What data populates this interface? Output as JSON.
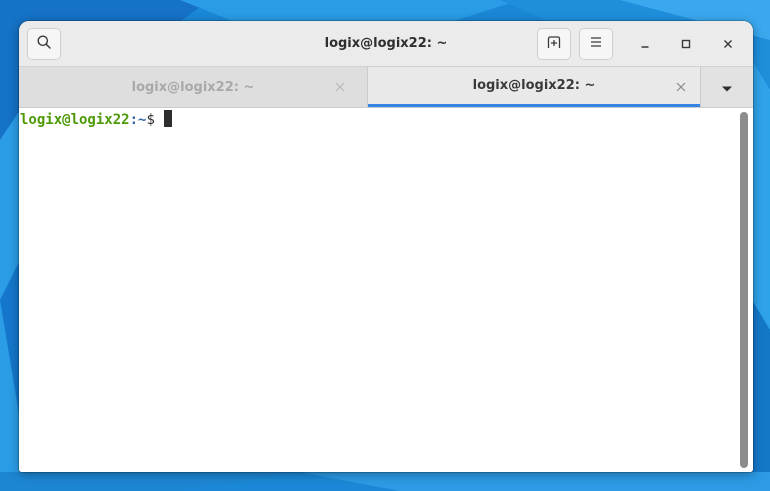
{
  "window": {
    "title": "logix@logix22: ~"
  },
  "headerbar": {
    "search_icon": "search-icon",
    "new_tab_icon": "new-tab-icon",
    "menu_icon": "hamburger-menu-icon",
    "minimize_icon": "minimize-icon",
    "maximize_icon": "maximize-icon",
    "close_icon": "close-icon"
  },
  "tabs": [
    {
      "label": "logix@logix22: ~",
      "active": false
    },
    {
      "label": "logix@logix22: ~",
      "active": true
    }
  ],
  "tab_menu_icon": "dropdown-arrow-icon",
  "terminal": {
    "prompt_user": "logix@logix22",
    "prompt_colon": ":",
    "prompt_path": "~",
    "prompt_symbol": "$"
  },
  "colors": {
    "prompt_user": "#4e9a06",
    "prompt_path": "#3465a4",
    "active_tab_indicator": "#3584e4",
    "desktop_background": "#1a88d6"
  }
}
